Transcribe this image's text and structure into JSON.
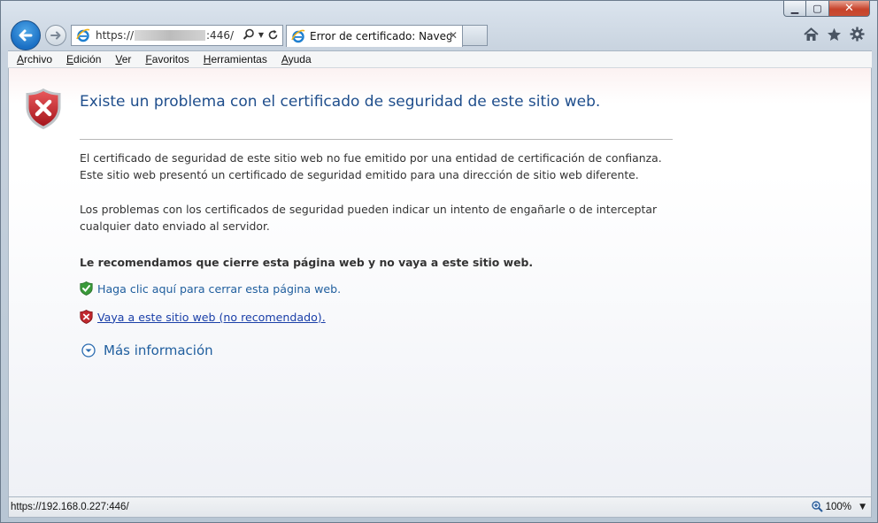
{
  "browser": {
    "address": {
      "prefix": "https://",
      "suffix": ":446/"
    },
    "tab": {
      "title": "Error de certificado: Navega...",
      "close_label": "✕"
    },
    "window_buttons": {
      "minimize": "▁",
      "maximize": "▢",
      "close": "✕"
    },
    "icons": [
      "back-arrow-icon",
      "forward-arrow-icon",
      "ie-logo-icon",
      "search-icon",
      "refresh-icon",
      "home-icon",
      "favorites-star-icon",
      "gear-icon"
    ]
  },
  "menu": {
    "items": [
      "Archivo",
      "Edición",
      "Ver",
      "Favoritos",
      "Herramientas",
      "Ayuda"
    ]
  },
  "page": {
    "title": "Existe un problema con el certificado de seguridad de este sitio web.",
    "paragraph1_line1": "El certificado de seguridad de este sitio web no fue emitido por una entidad de certificación de confianza.",
    "paragraph1_line2": "Este sitio web presentó un certificado de seguridad emitido para una dirección de sitio web diferente.",
    "paragraph2": "Los problemas con los certificados de seguridad pueden indicar un intento de engañarle o de interceptar cualquier dato enviado al servidor.",
    "recommendation": "Le recomendamos que cierre esta página web y no vaya a este sitio web.",
    "close_link": "Haga clic aquí para cerrar esta página web.",
    "continue_link": "Vaya a este sitio web (no recomendado).",
    "more_info": "Más información"
  },
  "status": {
    "url": "https://192.168.0.227:446/",
    "zoom": "100%"
  },
  "colors": {
    "title": "#1f4e8c",
    "link": "#1f5e9e",
    "shield_red": "#c0282e",
    "shield_green": "#3a9a3a"
  }
}
